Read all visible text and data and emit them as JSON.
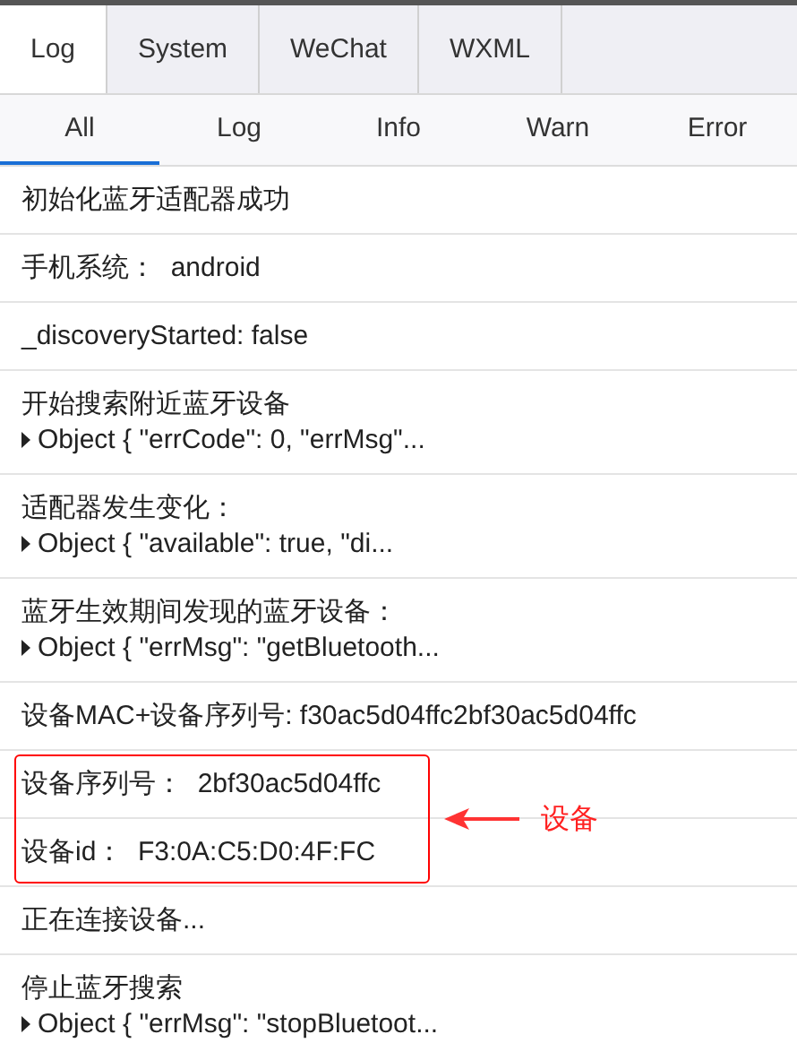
{
  "tabs": [
    {
      "label": "Log",
      "selected": true
    },
    {
      "label": "System",
      "selected": false
    },
    {
      "label": "WeChat",
      "selected": false
    },
    {
      "label": "WXML",
      "selected": false
    }
  ],
  "filters": [
    {
      "label": "All",
      "selected": true
    },
    {
      "label": "Log",
      "selected": false
    },
    {
      "label": "Info",
      "selected": false
    },
    {
      "label": "Warn",
      "selected": false
    },
    {
      "label": "Error",
      "selected": false
    }
  ],
  "entries": [
    {
      "kind": "text",
      "text": "初始化蓝牙适配器成功",
      "annotated": false
    },
    {
      "kind": "text",
      "text": "手机系统：  android",
      "annotated": false
    },
    {
      "kind": "text",
      "text": "_discoveryStarted: false",
      "annotated": false
    },
    {
      "kind": "object",
      "text": "开始搜索附近蓝牙设备",
      "object": "Object { \"errCode\": 0, \"errMsg\"...",
      "annotated": false
    },
    {
      "kind": "object",
      "text": "适配器发生变化：",
      "object": "Object { \"available\": true, \"di...",
      "annotated": false
    },
    {
      "kind": "object",
      "text": "蓝牙生效期间发现的蓝牙设备：",
      "object": "Object { \"errMsg\": \"getBluetooth...",
      "annotated": false
    },
    {
      "kind": "text",
      "text": "设备MAC+设备序列号: f30ac5d04ffc2bf30ac5d04ffc",
      "annotated": false
    },
    {
      "kind": "text",
      "text": "设备序列号：  2bf30ac5d04ffc",
      "annotated": true
    },
    {
      "kind": "text",
      "text": "设备id：  F3:0A:C5:D0:4F:FC",
      "annotated": true
    },
    {
      "kind": "text",
      "text": "正在连接设备...",
      "annotated": false
    },
    {
      "kind": "object",
      "text": "停止蓝牙搜索",
      "object": "Object { \"errMsg\": \"stopBluetoot...",
      "annotated": false
    }
  ],
  "annotation": {
    "label": "设备"
  }
}
